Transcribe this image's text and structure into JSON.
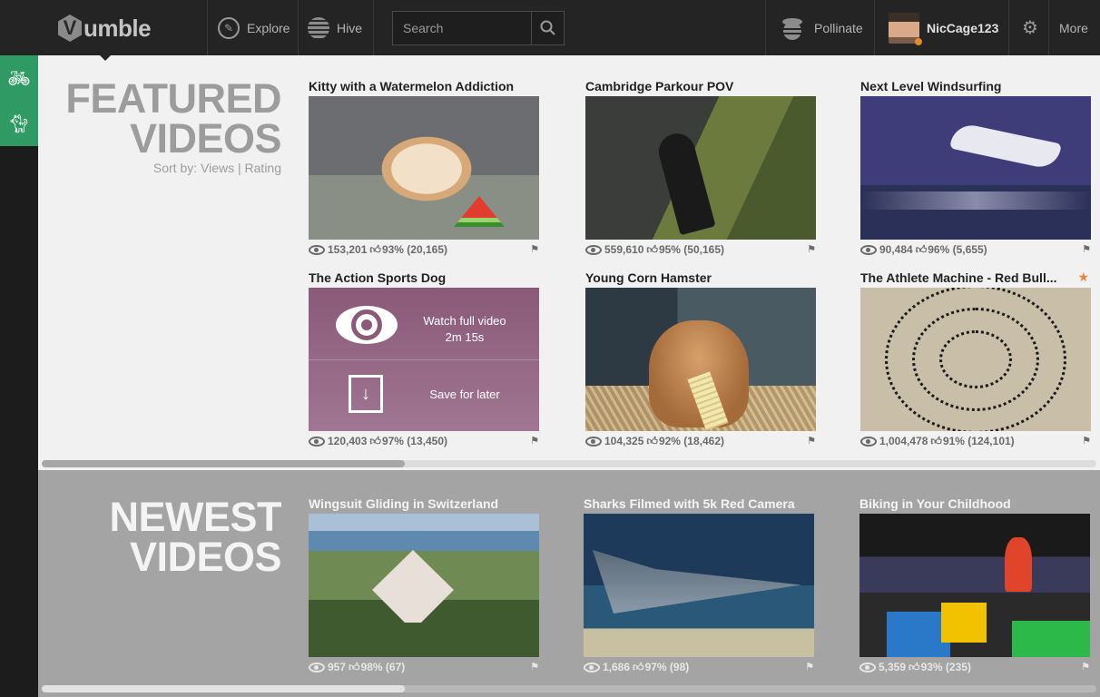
{
  "brand": {
    "name": "umble",
    "mark": "V"
  },
  "nav": {
    "explore": "Explore",
    "hive": "Hive",
    "pollinate": "Pollinate",
    "username": "NicCage123",
    "more": "More"
  },
  "search": {
    "placeholder": "Search"
  },
  "featured": {
    "title_line1": "FEATURED",
    "title_line2": "VIDEOS",
    "sort_prefix": "Sort by:",
    "sort_views": "Views",
    "sort_sep": "|",
    "sort_rating": "Rating",
    "videos": [
      {
        "title": "Kitty with a Watermelon Addiction",
        "views": "153,201",
        "rating": "93% (20,165)"
      },
      {
        "title": "Cambridge Parkour POV",
        "views": "559,610",
        "rating": "95% (50,165)"
      },
      {
        "title": "Next Level Windsurfing",
        "views": "90,484",
        "rating": "96% (5,655)"
      },
      {
        "title": "The Action Sports Dog",
        "views": "120,403",
        "rating": "97% (13,450)",
        "overlay_watch": "Watch full video",
        "overlay_duration": "2m 15s",
        "overlay_save": "Save for later"
      },
      {
        "title": "Young Corn Hamster",
        "views": "104,325",
        "rating": "92% (18,462)"
      },
      {
        "title": "The Athlete Machine - Red Bull...",
        "views": "1,004,478",
        "rating": "91% (124,101)",
        "starred": true
      }
    ]
  },
  "newest": {
    "title_line1": "NEWEST",
    "title_line2": "VIDEOS",
    "videos": [
      {
        "title": "Wingsuit Gliding in Switzerland",
        "views": "957",
        "rating": "98% (67)"
      },
      {
        "title": "Sharks Filmed with 5k Red Camera",
        "views": "1,686",
        "rating": "97% (98)"
      },
      {
        "title": "Biking in Your Childhood",
        "views": "5,359",
        "rating": "93% (235)"
      }
    ]
  },
  "colors": {
    "accent_green": "#2f9a64",
    "star_orange": "#e08a3a",
    "topbar": "#242424"
  },
  "icons": [
    "compass-icon",
    "hive-icon",
    "search-icon",
    "bee-icon",
    "gear-icon",
    "bike-icon",
    "cat-icon",
    "eye-icon",
    "thumbs-up-icon",
    "flag-icon",
    "star-icon",
    "download-icon"
  ]
}
